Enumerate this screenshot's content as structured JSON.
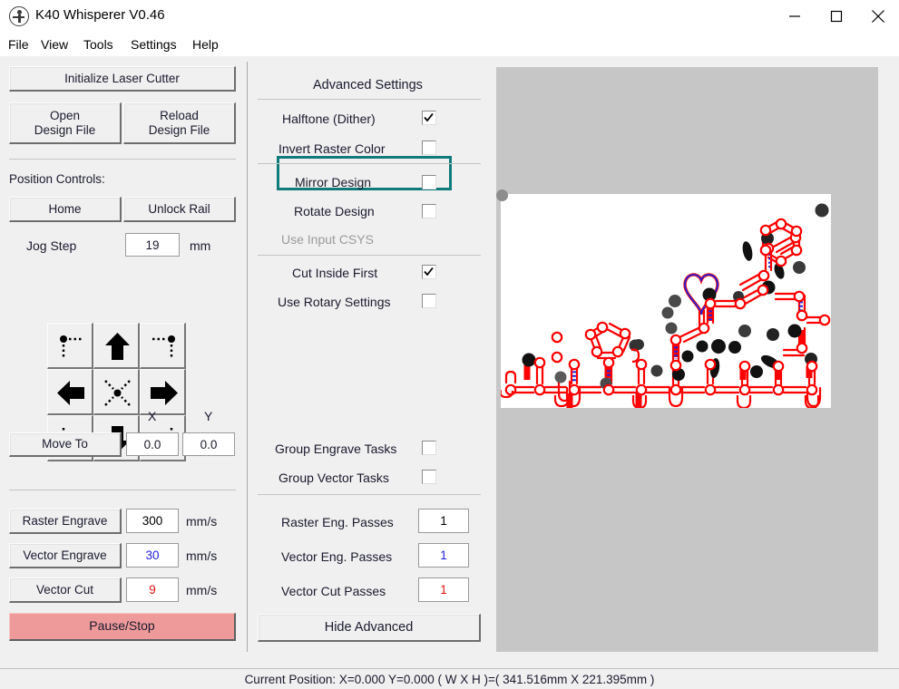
{
  "window": {
    "title": "K40 Whisperer V0.46",
    "icon": "app-person-icon",
    "minimize": "minimize-icon",
    "maximize": "maximize-icon",
    "close": "close-icon"
  },
  "menubar": {
    "items": [
      {
        "label": "File"
      },
      {
        "label": "View"
      },
      {
        "label": "Tools"
      },
      {
        "label": "Settings"
      },
      {
        "label": "Help"
      }
    ]
  },
  "left_panel": {
    "initialize_button": "Initialize Laser Cutter",
    "open_design_file": {
      "line1": "Open",
      "line2": "Design File"
    },
    "reload_design_file": {
      "line1": "Reload",
      "line2": "Design File"
    },
    "position_controls_label": "Position Controls:",
    "home_button": "Home",
    "unlock_rail_button": "Unlock Rail",
    "jog_step_label": "Jog Step",
    "jog_step_value": "19",
    "jog_step_units": "mm",
    "jog_buttons": [
      {
        "name": "jog-top-left",
        "icon": "corner-top-left-icon"
      },
      {
        "name": "jog-up",
        "icon": "arrow-up-icon"
      },
      {
        "name": "jog-top-right",
        "icon": "corner-top-right-icon"
      },
      {
        "name": "jog-left",
        "icon": "arrow-left-icon"
      },
      {
        "name": "jog-center",
        "icon": "center-cross-icon"
      },
      {
        "name": "jog-right",
        "icon": "arrow-right-icon"
      },
      {
        "name": "jog-bottom-left",
        "icon": "corner-bottom-left-icon"
      },
      {
        "name": "jog-down",
        "icon": "arrow-down-icon"
      },
      {
        "name": "jog-bottom-right",
        "icon": "corner-bottom-right-icon"
      }
    ],
    "x_label": "X",
    "y_label": "Y",
    "move_to_button": "Move To",
    "move_to_x": "0.0",
    "move_to_y": "0.0",
    "speeds": [
      {
        "button": "Raster Engrave",
        "value": "300",
        "units": "mm/s",
        "color": "#000000"
      },
      {
        "button": "Vector Engrave",
        "value": "30",
        "units": "mm/s",
        "color": "#2222dd"
      },
      {
        "button": "Vector Cut",
        "value": "9",
        "units": "mm/s",
        "color": "#e01010"
      }
    ],
    "pause_stop_button": "Pause/Stop"
  },
  "advanced_panel": {
    "title": "Advanced Settings",
    "highlight_color": "#0f7b7b",
    "checkboxes": [
      {
        "label": "Halftone (Dither)",
        "checked": true,
        "highlighted": true
      },
      {
        "label": "Invert Raster Color",
        "checked": false,
        "highlighted": false
      },
      {
        "label": "Mirror Design",
        "checked": false,
        "highlighted": false
      },
      {
        "label": "Rotate Design",
        "checked": false,
        "highlighted": false
      },
      {
        "label": "Use Input CSYS",
        "checked": false,
        "disabled": true
      },
      {
        "label": "Cut Inside First",
        "checked": true,
        "highlighted": false
      },
      {
        "label": "Use Rotary Settings",
        "checked": false,
        "highlighted": false
      },
      {
        "label": "Group Engrave Tasks",
        "checked": false,
        "highlighted": false
      },
      {
        "label": "Group Vector Tasks",
        "checked": false,
        "highlighted": false
      }
    ],
    "passes": [
      {
        "label": "Raster Eng. Passes",
        "value": "1",
        "color": "#000000"
      },
      {
        "label": "Vector Eng. Passes",
        "value": "1",
        "color": "#2222dd"
      },
      {
        "label": "Vector Cut Passes",
        "value": "1",
        "color": "#e01010"
      }
    ],
    "hide_advanced_button": "Hide Advanced"
  },
  "canvas": {
    "background_color": "#c6c6c6",
    "design_background": "#ffffff",
    "origin_marker": "origin-dot",
    "design_description": "peptide-molecule-with-heart",
    "cut_color": "#ff0000",
    "engrave_color": "#2222dd",
    "raster_color": "#1a1a1a"
  },
  "statusbar": {
    "text": "Current Position: X=0.000 Y=0.000   ( W X H )=( 341.516mm X 221.395mm )"
  }
}
